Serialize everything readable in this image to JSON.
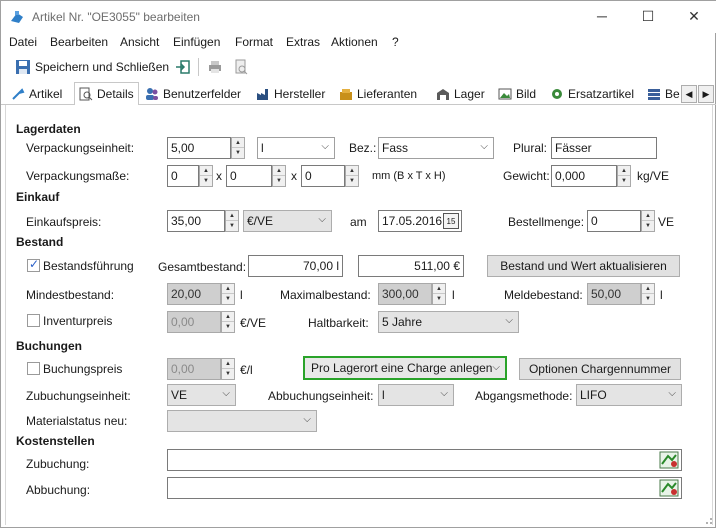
{
  "window": {
    "title": "Artikel Nr. \"OE3055\" bearbeiten",
    "buttons": {
      "minimize": "─",
      "maximize": "☐",
      "close": "✕"
    }
  },
  "menu": [
    "Datei",
    "Bearbeiten",
    "Ansicht",
    "Einfügen",
    "Format",
    "Extras",
    "Aktionen",
    "?"
  ],
  "toolbar": {
    "save_close": "Speichern und Schließen"
  },
  "tabs": [
    "Artikel",
    "Details",
    "Benutzerfelder",
    "Hersteller",
    "Lieferanten",
    "Lager",
    "Bild",
    "Ersatzartikel",
    "Be"
  ],
  "lagerdaten": {
    "heading": "Lagerdaten",
    "ve_label": "Verpackungseinheit:",
    "ve_value": "5,00",
    "ve_unit": "l",
    "bez_label": "Bez.:",
    "bez_value": "Fass",
    "plural_label": "Plural:",
    "plural_value": "Fässer",
    "masse_label": "Verpackungsmaße:",
    "masse_1": "0",
    "masse_2": "0",
    "masse_3": "0",
    "x1": "x",
    "x2": "x",
    "masse_unit": "mm (B x T x H)",
    "gewicht_label": "Gewicht:",
    "gewicht_value": "0,000",
    "gewicht_unit": "kg/VE"
  },
  "einkauf": {
    "heading": "Einkauf",
    "preis_label": "Einkaufspreis:",
    "preis_value": "35,00",
    "preis_unit": "€/VE",
    "am_label": "am",
    "datum": "17.05.2016",
    "cal_icon": "15",
    "bestell_label": "Bestellmenge:",
    "bestell_value": "0",
    "bestell_unit": "VE"
  },
  "bestand": {
    "heading": "Bestand",
    "fuehrung_label": "Bestandsführung",
    "gesamt_label": "Gesamtbestand:",
    "gesamt_menge": "70,00 l",
    "gesamt_wert": "511,00 €",
    "aktualisieren": "Bestand und Wert aktualisieren",
    "min_label": "Mindestbestand:",
    "min_value": "20,00",
    "min_unit": "l",
    "max_label": "Maximalbestand:",
    "max_value": "300,00",
    "max_unit": "l",
    "melde_label": "Meldebestand:",
    "melde_value": "50,00",
    "melde_unit": "l",
    "inventur_label": "Inventurpreis",
    "inventur_value": "0,00",
    "inventur_unit": "€/VE",
    "haltbar_label": "Haltbarkeit:",
    "haltbar_value": "5 Jahre"
  },
  "buchungen": {
    "heading": "Buchungen",
    "preis_label": "Buchungspreis",
    "preis_value": "0,00",
    "preis_unit": "€/l",
    "charge_select": "Pro Lagerort eine Charge anlegen",
    "charge_btn": "Optionen Chargennummer",
    "zu_label": "Zubuchungseinheit:",
    "zu_value": "VE",
    "ab_label": "Abbuchungseinheit:",
    "ab_value": "l",
    "methode_label": "Abgangsmethode:",
    "methode_value": "LIFO",
    "status_label": "Materialstatus neu:",
    "status_value": ""
  },
  "kostenstellen": {
    "heading": "Kostenstellen",
    "zu_label": "Zubuchung:",
    "zu_value": "",
    "ab_label": "Abbuchung:",
    "ab_value": ""
  }
}
